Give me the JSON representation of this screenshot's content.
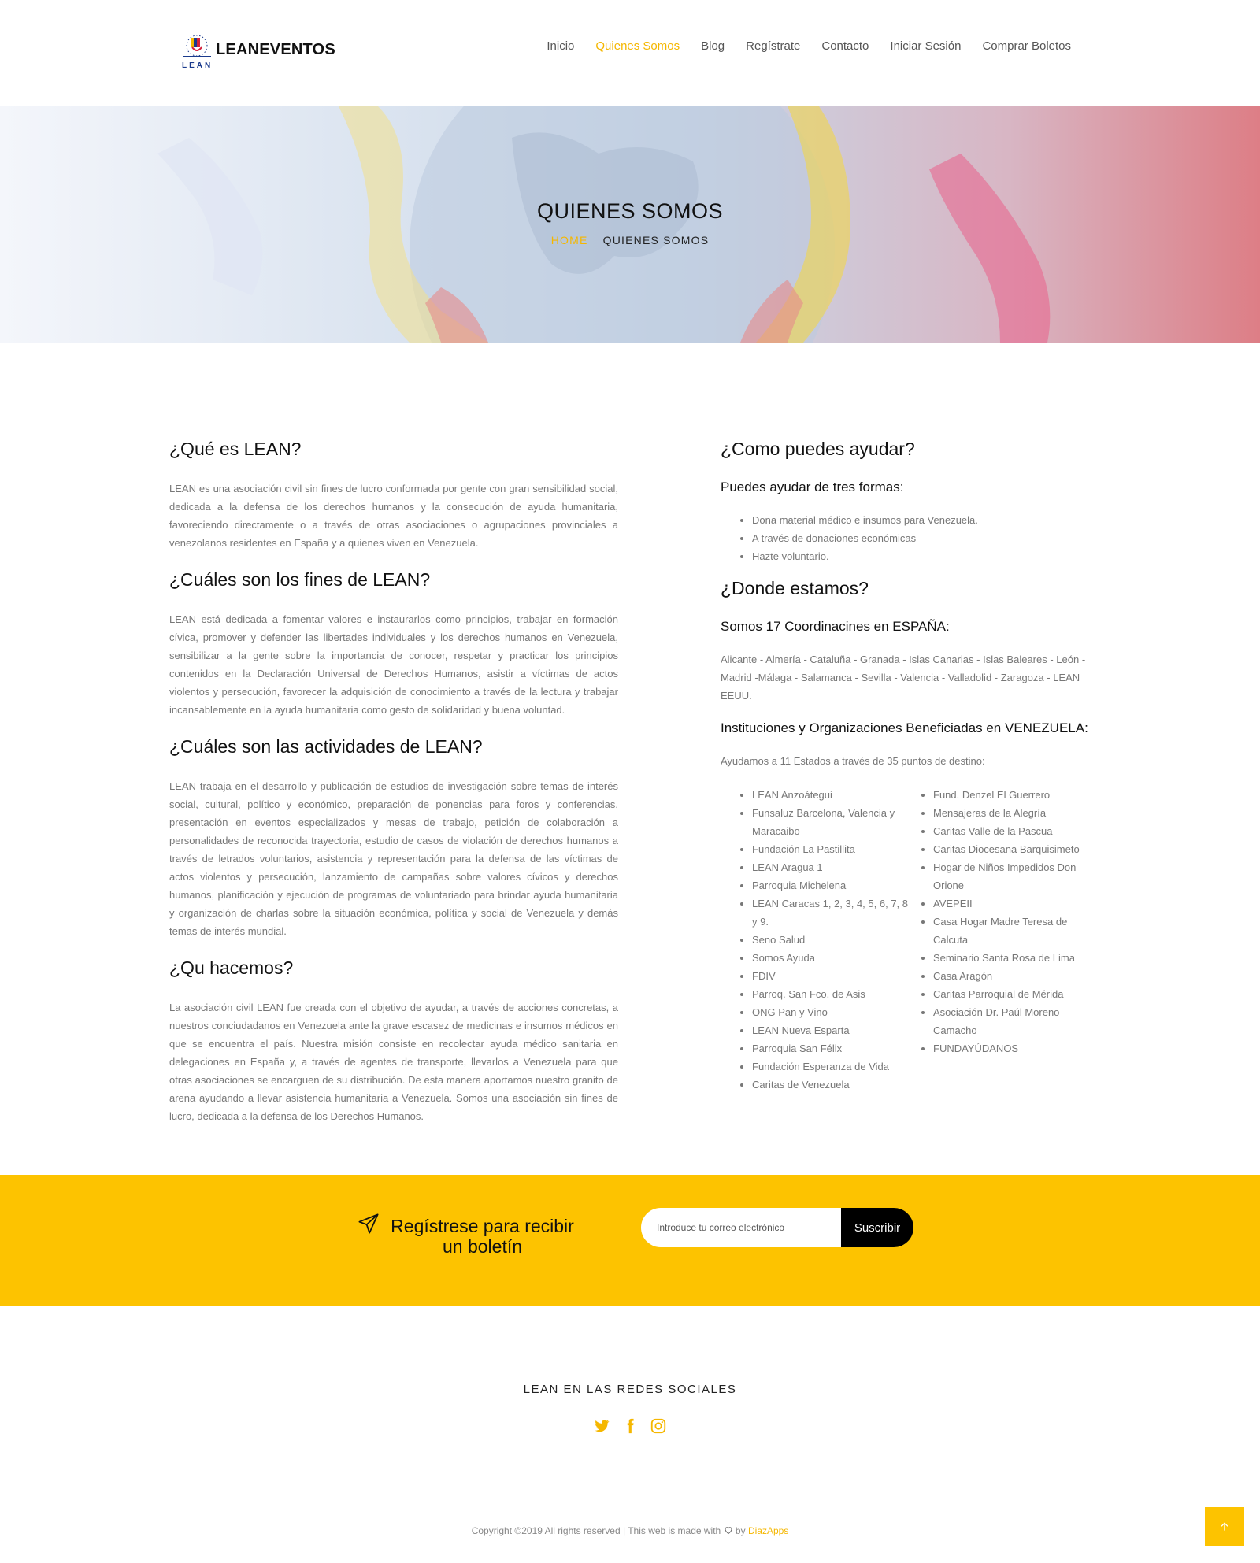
{
  "header": {
    "logo_text": "LEANEVENTOS",
    "logo_sub": "LEAN",
    "nav": [
      {
        "label": "Inicio",
        "active": false
      },
      {
        "label": "Quienes Somos",
        "active": true
      },
      {
        "label": "Blog",
        "active": false
      },
      {
        "label": "Regístrate",
        "active": false
      },
      {
        "label": "Contacto",
        "active": false
      },
      {
        "label": "Iniciar Sesión",
        "active": false
      },
      {
        "label": "Comprar Boletos",
        "active": false
      }
    ]
  },
  "hero": {
    "title": "QUIENES SOMOS",
    "breadcrumb_home": "HOME",
    "breadcrumb_current": "QUIENES SOMOS"
  },
  "left": {
    "s1_title": "¿Qué es LEAN?",
    "s1_text": "LEAN es una asociación civil sin fines de lucro conformada por gente con gran sensibilidad social, dedicada a la defensa de los derechos humanos y la consecución de ayuda humanitaria, favoreciendo directamente o a través de otras asociaciones o agrupaciones provinciales a venezolanos residentes en España y a quienes viven en Venezuela.",
    "s2_title": "¿Cuáles son los fines de LEAN?",
    "s2_text": "LEAN está dedicada a fomentar valores e instaurarlos como principios, trabajar en formación cívica, promover y defender las libertades individuales y los derechos humanos en Venezuela, sensibilizar a la gente sobre la importancia de conocer, respetar y practicar los principios contenidos en la Declaración Universal de Derechos Humanos, asistir a víctimas de actos violentos y persecución, favorecer la adquisición de conocimiento a través de la lectura y trabajar incansablemente en la ayuda humanitaria como gesto de solidaridad y buena voluntad.",
    "s3_title": "¿Cuáles son las actividades de LEAN?",
    "s3_text": "LEAN trabaja en el desarrollo y publicación de estudios de investigación sobre temas de interés social, cultural, político y económico, preparación de ponencias para foros y conferencias, presentación en eventos especializados y mesas de trabajo, petición de colaboración a personalidades de reconocida trayectoria, estudio de casos de violación de derechos humanos a través de letrados voluntarios, asistencia y representación para la defensa de las víctimas de actos violentos y persecución, lanzamiento de campañas sobre valores cívicos y derechos humanos, planificación y ejecución de programas de voluntariado para brindar ayuda humanitaria y organización de charlas sobre la situación económica, política y social de Venezuela y demás temas de interés mundial.",
    "s4_title": "¿Qu hacemos?",
    "s4_text": "La asociación civil LEAN fue creada con el objetivo de ayudar, a través de acciones concretas, a nuestros conciudadanos en Venezuela ante la grave escasez de medicinas e insumos médicos en que se encuentra el país. Nuestra misión consiste en recolectar ayuda médico sanitaria en delegaciones en España y, a través de agentes de transporte, llevarlos a Venezuela para que otras asociaciones se encarguen de su distribución. De esta manera aportamos nuestro granito de arena ayudando a llevar asistencia humanitaria a Venezuela. Somos una asociación sin fines de lucro, dedicada a la defensa de los Derechos Humanos."
  },
  "right": {
    "s1_title": "¿Como puedes ayudar?",
    "s1_sub": "Puedes ayudar de tres formas:",
    "help_items": [
      "Dona material médico e insumos para Venezuela.",
      "A través de donaciones económicas",
      "Hazte voluntario."
    ],
    "s2_title": "¿Donde estamos?",
    "s2_sub": "Somos 17 Coordinacines en ESPAÑA:",
    "s2_text": "Alicante - Almería - Cataluña - Granada - Islas Canarias - Islas Baleares - León - Madrid -Málaga - Salamanca - Sevilla - Valencia - Valladolid - Zaragoza - LEAN EEUU.",
    "s3_sub": "Instituciones y Organizaciones Beneficiadas en VENEZUELA:",
    "s3_text": "Ayudamos a 11 Estados a través de 35 puntos de destino:",
    "list_a": [
      "LEAN Anzoátegui",
      "Funsaluz Barcelona, Valencia y Maracaibo",
      "Fundación La Pastillita",
      "LEAN Aragua 1",
      "Parroquia Michelena",
      "LEAN Caracas 1, 2, 3, 4, 5, 6, 7, 8 y 9.",
      "Seno Salud",
      "Somos Ayuda",
      "FDIV",
      "Parroq. San Fco. de Asis",
      "ONG Pan y Vino",
      "LEAN Nueva Esparta",
      "Parroquia San Félix",
      "Fundación Esperanza de Vida",
      "Caritas de Venezuela"
    ],
    "list_b": [
      "Fund. Denzel El Guerrero",
      "Mensajeras de la Alegría",
      "Caritas Valle de la Pascua",
      "Caritas Diocesana Barquisimeto",
      "Hogar de Niños Impedidos Don Orione",
      "AVEPEII",
      "Casa Hogar Madre Teresa de Calcuta",
      "Seminario Santa Rosa de Lima",
      "Casa Aragón",
      "Caritas Parroquial de Mérida",
      "Asociación Dr. Paúl Moreno Camacho",
      "FUNDAYÚDANOS"
    ]
  },
  "newsletter": {
    "text": "Regístrese para recibir un boletín",
    "placeholder": "Introduce tu correo electrónico",
    "button": "Suscribir"
  },
  "footer": {
    "social_title": "LEAN EN LAS REDES SOCIALES",
    "social_icons": [
      "twitter-icon",
      "facebook-icon",
      "instagram-icon"
    ],
    "copyright_prefix": "Copyright ©2019 All rights reserved | This web is made with",
    "copyright_by": "by",
    "copyright_brand": "DiazApps"
  },
  "colors": {
    "accent": "#f5b700",
    "newsletter_bg": "#fdc300",
    "button_bg": "#000000"
  }
}
